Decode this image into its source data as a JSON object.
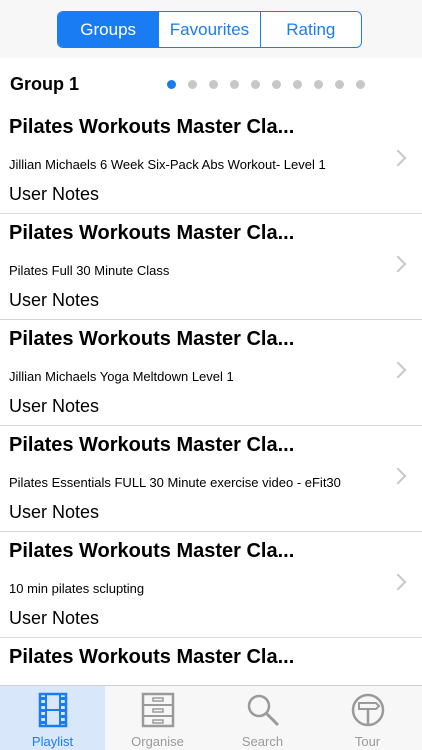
{
  "segments": [
    {
      "label": "Groups",
      "active": true
    },
    {
      "label": "Favourites",
      "active": false
    },
    {
      "label": "Rating",
      "active": false
    }
  ],
  "group": {
    "title": "Group 1",
    "page_count": 10,
    "current_page": 1
  },
  "rows": [
    {
      "title": "Pilates Workouts Master Cla...",
      "subtitle": "Jillian Michaels 6 Week Six-Pack Abs Workout- Level 1",
      "notes": "User Notes"
    },
    {
      "title": "Pilates Workouts Master Cla...",
      "subtitle": "Pilates Full 30 Minute Class",
      "notes": "User Notes"
    },
    {
      "title": "Pilates Workouts Master Cla...",
      "subtitle": "Jillian Michaels Yoga Meltdown Level 1",
      "notes": "User Notes"
    },
    {
      "title": "Pilates Workouts Master Cla...",
      "subtitle": "Pilates Essentials FULL 30 Minute exercise video - eFit30",
      "notes": "User Notes"
    },
    {
      "title": "Pilates Workouts Master Cla...",
      "subtitle": "10 min pilates sclupting",
      "notes": "User Notes"
    },
    {
      "title": "Pilates Workouts Master Cla...",
      "subtitle": "",
      "notes": ""
    }
  ],
  "tabs": [
    {
      "label": "Playlist",
      "icon": "film-icon",
      "active": true
    },
    {
      "label": "Organise",
      "icon": "cabinet-icon",
      "active": false
    },
    {
      "label": "Search",
      "icon": "search-icon",
      "active": false
    },
    {
      "label": "Tour",
      "icon": "signpost-icon",
      "active": false
    }
  ],
  "colors": {
    "accent": "#1a7cf2",
    "inactive": "#9a9a9a"
  }
}
